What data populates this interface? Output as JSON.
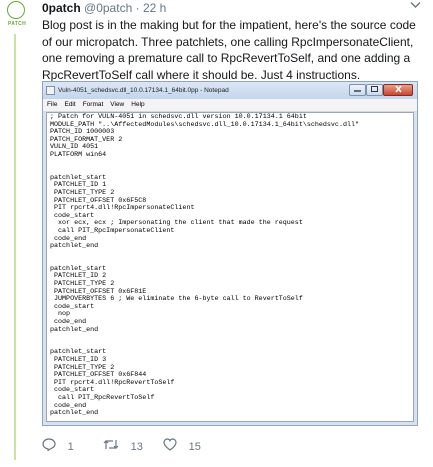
{
  "avatar": {
    "label": "PATCH"
  },
  "tweet": {
    "author_name": "0patch",
    "author_handle": "@0patch",
    "separator": "·",
    "time": "22 h",
    "text": "Blog post is in the making but for the impatient, here's the source code of our micropatch. Three patchlets, one calling RpcImpersonateClient, one removing a premature call to RpcRevertToSelf, and one adding a RpcRevertToSelf call where it should be. Just 4 instructions."
  },
  "notepad": {
    "title": "Vuln-4051_schedsvc.dll_10.0.17134.1_64bit.0pp - Notepad",
    "menu": [
      "File",
      "Edit",
      "Format",
      "View",
      "Help"
    ],
    "content": "; Patch for VULN-4051 in schedsvc.dll version 10.0.17134.1 64bit\nMODULE_PATH \"..\\AffectedModules\\schedsvc.dll_10.0.17134.1_64bit\\schedsvc.dll\"\nPATCH_ID 1000003\nPATCH_FORMAT_VER 2\nVULN_ID 4051\nPLATFORM win64\n\n\npatchlet_start\n PATCHLET_ID 1\n PATCHLET_TYPE 2\n PATCHLET_OFFSET 0x6F5C8\n PIT rpcrt4.dll!RpcImpersonateClient\n code_start\n  xor ecx, ecx ; Impersonating the client that made the request\n  call PIT_RpcImpersonateClient\n code_end\npatchlet_end\n\n\npatchlet_start\n PATCHLET_ID 2\n PATCHLET_TYPE 2\n PATCHLET_OFFSET 0x6F81E\n JUMPOVERBYTES 6 ; We eliminate the 6-byte call to RevertToSelf\n code_start\n  nop\n code_end\npatchlet_end\n\n\npatchlet_start\n PATCHLET_ID 3\n PATCHLET_TYPE 2\n PATCHLET_OFFSET 0x6F844\n PIT rpcrt4.dll!RpcRevertToSelf\n code_start\n  call PIT_RpcRevertToSelf\n code_end\npatchlet_end"
  },
  "actions": {
    "reply_count": "1",
    "retweet_count": "13",
    "like_count": "15"
  },
  "icons": {
    "chevron": "chevron-down-icon",
    "reply": "reply-icon",
    "retweet": "retweet-icon",
    "like": "heart-icon"
  },
  "colors": {
    "brand_green": "#6fa63a",
    "muted_text": "#657786"
  }
}
